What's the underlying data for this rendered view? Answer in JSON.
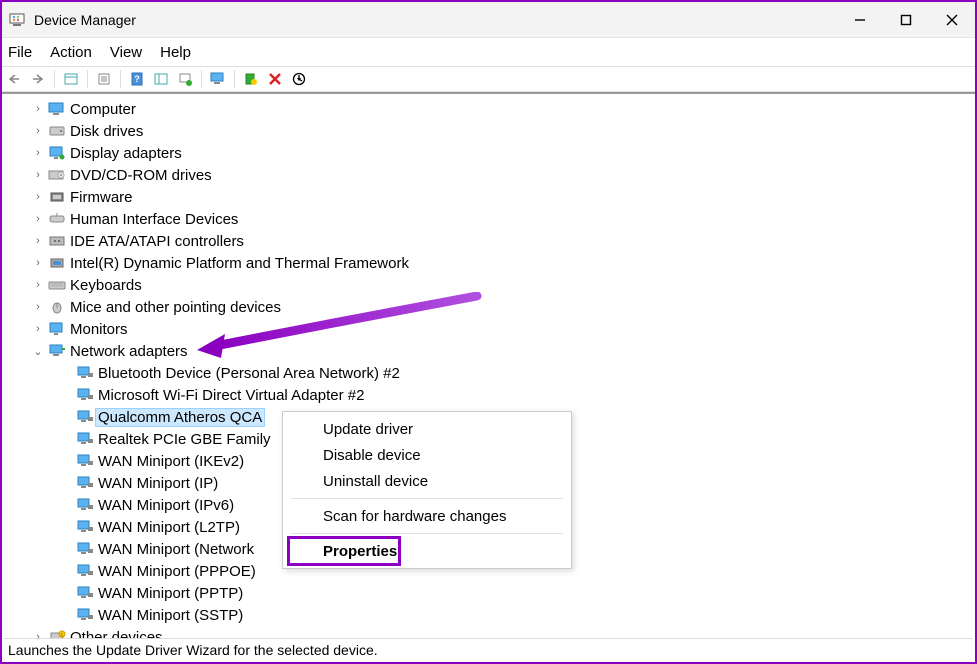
{
  "window": {
    "title": "Device Manager"
  },
  "menubar": [
    "File",
    "Action",
    "View",
    "Help"
  ],
  "tree": [
    {
      "label": "Computer",
      "expander": ">",
      "icon": "computer"
    },
    {
      "label": "Disk drives",
      "expander": ">",
      "icon": "disk"
    },
    {
      "label": "Display adapters",
      "expander": ">",
      "icon": "display"
    },
    {
      "label": "DVD/CD-ROM drives",
      "expander": ">",
      "icon": "dvd"
    },
    {
      "label": "Firmware",
      "expander": ">",
      "icon": "firmware"
    },
    {
      "label": "Human Interface Devices",
      "expander": ">",
      "icon": "hid"
    },
    {
      "label": "IDE ATA/ATAPI controllers",
      "expander": ">",
      "icon": "ide"
    },
    {
      "label": "Intel(R) Dynamic Platform and Thermal Framework",
      "expander": ">",
      "icon": "intel"
    },
    {
      "label": "Keyboards",
      "expander": ">",
      "icon": "keyboard"
    },
    {
      "label": "Mice and other pointing devices",
      "expander": ">",
      "icon": "mouse"
    },
    {
      "label": "Monitors",
      "expander": ">",
      "icon": "monitor"
    },
    {
      "label": "Network adapters",
      "expander": "v",
      "icon": "network",
      "children": [
        {
          "label": "Bluetooth Device (Personal Area Network) #2"
        },
        {
          "label": "Microsoft Wi-Fi Direct Virtual Adapter #2"
        },
        {
          "label": "Qualcomm Atheros QCA",
          "selected": true
        },
        {
          "label": "Realtek PCIe GBE Family"
        },
        {
          "label": "WAN Miniport (IKEv2)"
        },
        {
          "label": "WAN Miniport (IP)"
        },
        {
          "label": "WAN Miniport (IPv6)"
        },
        {
          "label": "WAN Miniport (L2TP)"
        },
        {
          "label": "WAN Miniport (Network"
        },
        {
          "label": "WAN Miniport (PPPOE)"
        },
        {
          "label": "WAN Miniport (PPTP)"
        },
        {
          "label": "WAN Miniport (SSTP)"
        }
      ]
    },
    {
      "label": "Other devices",
      "expander": ">",
      "icon": "other"
    }
  ],
  "context_menu": [
    {
      "label": "Update driver"
    },
    {
      "label": "Disable device"
    },
    {
      "label": "Uninstall device"
    },
    {
      "sep": true
    },
    {
      "label": "Scan for hardware changes"
    },
    {
      "sep": true
    },
    {
      "label": "Properties",
      "highlighted": true
    }
  ],
  "statusbar": "Launches the Update Driver Wizard for the selected device."
}
